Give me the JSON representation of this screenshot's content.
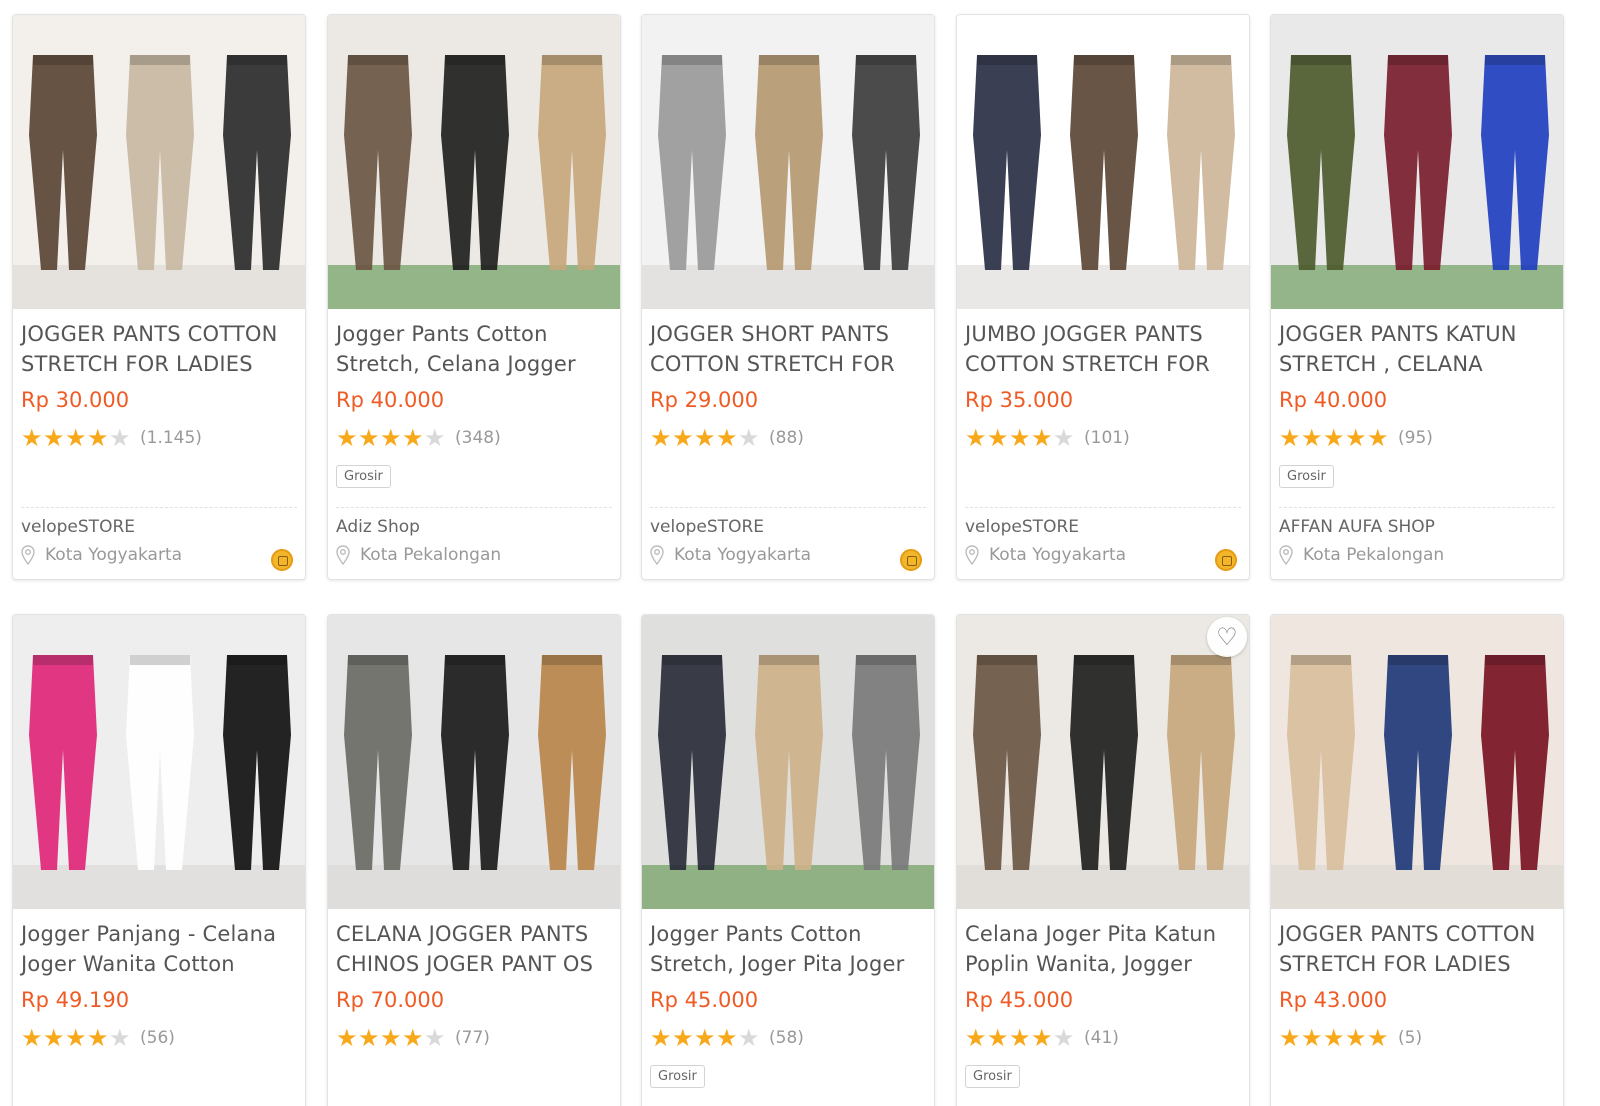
{
  "products": [
    {
      "title": "JOGGER PANTS COTTON STRETCH FOR LADIES",
      "price": "Rp 30.000",
      "rating": 4,
      "reviews": "(1.145)",
      "badge": "",
      "shop": "velopeSTORE",
      "location": "Kota Yogyakarta",
      "gold_merchant": true,
      "image_palette": [
        "#f3f0ec",
        "#5a4535",
        "#c9b8a3",
        "#2b2b2b"
      ]
    },
    {
      "title": "Jogger Pants Cotton Stretch, Celana Jogger",
      "price": "Rp 40.000",
      "rating": 4,
      "reviews": "(348)",
      "badge": "Grosir",
      "shop": "Adiz Shop",
      "location": "Kota Pekalongan",
      "gold_merchant": false,
      "image_palette": [
        "#ece9e4",
        "#6b5644",
        "#1f1f1f",
        "#c7a77c"
      ]
    },
    {
      "title": "JOGGER SHORT PANTS COTTON STRETCH FOR",
      "price": "Rp 29.000",
      "rating": 4,
      "reviews": "(88)",
      "badge": "",
      "shop": "velopeSTORE",
      "location": "Kota Yogyakarta",
      "gold_merchant": true,
      "image_palette": [
        "#f2f2f2",
        "#9a9a9a",
        "#b59a72",
        "#3d3d3d"
      ]
    },
    {
      "title": "JUMBO JOGGER PANTS COTTON STRETCH FOR",
      "price": "Rp 35.000",
      "rating": 4,
      "reviews": "(101)",
      "badge": "",
      "shop": "velopeSTORE",
      "location": "Kota Yogyakarta",
      "gold_merchant": true,
      "image_palette": [
        "#ffffff",
        "#2a2f45",
        "#5b4736",
        "#cdb69a"
      ]
    },
    {
      "title": "JOGGER PANTS KATUN STRETCH , CELANA",
      "price": "Rp 40.000",
      "rating": 5,
      "reviews": "(95)",
      "badge": "Grosir",
      "shop": "AFFAN AUFA SHOP",
      "location": "Kota Pekalongan",
      "gold_merchant": false,
      "image_palette": [
        "#e9e9e9",
        "#4d5a2c",
        "#7a1d2c",
        "#1f3fbf"
      ]
    },
    {
      "title": "Jogger Panjang - Celana Joger Wanita Cotton",
      "price": "Rp 49.190",
      "rating": 4,
      "reviews": "(56)",
      "badge": "",
      "shop": "",
      "location": "",
      "gold_merchant": false,
      "image_palette": [
        "#eeeeee",
        "#e0277a",
        "#ffffff",
        "#111111"
      ]
    },
    {
      "title": "CELANA JOGGER PANTS CHINOS JOGER PANT OS",
      "price": "Rp 70.000",
      "rating": 4,
      "reviews": "(77)",
      "badge": "",
      "shop": "",
      "location": "",
      "gold_merchant": false,
      "image_palette": [
        "#e6e6e6",
        "#6b6b66",
        "#1b1b1b",
        "#b8864b"
      ]
    },
    {
      "title": "Jogger Pants Cotton Stretch, Joger Pita Joger",
      "price": "Rp 45.000",
      "rating": 4,
      "reviews": "(58)",
      "badge": "Grosir",
      "shop": "",
      "location": "",
      "gold_merchant": false,
      "image_palette": [
        "#dfe0de",
        "#2a2d3a",
        "#cdb28a",
        "#7a7a7a"
      ]
    },
    {
      "title": "Celana Joger Pita Katun Poplin Wanita, Jogger",
      "price": "Rp 45.000",
      "rating": 4,
      "reviews": "(41)",
      "badge": "Grosir",
      "shop": "",
      "location": "",
      "gold_merchant": false,
      "image_palette": [
        "#ece9e4",
        "#6b5644",
        "#1f1f1f",
        "#c7a77c"
      ]
    },
    {
      "title": "JOGGER PANTS COTTON STRETCH FOR LADIES",
      "price": "Rp 43.000",
      "rating": 5,
      "reviews": "(5)",
      "badge": "",
      "shop": "",
      "location": "",
      "gold_merchant": false,
      "image_palette": [
        "#efe7df",
        "#d8bf9d",
        "#1f3a7a",
        "#7a1424"
      ]
    }
  ],
  "colors": {
    "price": "#ef5b25",
    "star_on": "#f7a91b",
    "star_off": "#d9d9d9"
  },
  "icons": [
    "location-pin-icon",
    "gold-merchant-icon",
    "star-icon",
    "heart-icon"
  ]
}
